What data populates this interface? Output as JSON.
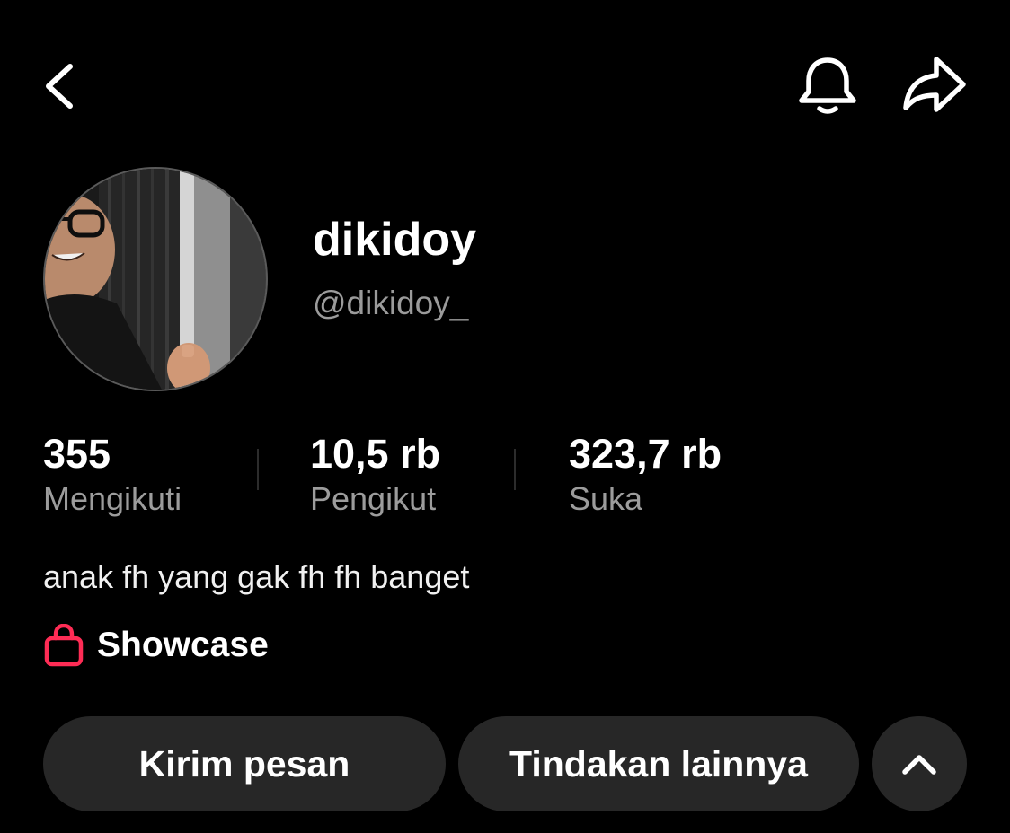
{
  "header": {
    "back_icon": "chevron-left-icon",
    "notifications_icon": "bell-icon",
    "share_icon": "share-arrow-icon"
  },
  "profile": {
    "display_name": "dikidoy",
    "username": "@dikidoy_",
    "bio": "anak fh yang gak fh fh banget"
  },
  "stats": [
    {
      "value": "355",
      "label": "Mengikuti"
    },
    {
      "value": "10,5 rb",
      "label": "Pengikut"
    },
    {
      "value": "323,7 rb",
      "label": "Suka"
    }
  ],
  "showcase": {
    "label": "Showcase",
    "icon": "shopping-bag-icon",
    "icon_color": "#fe2c55"
  },
  "actions": {
    "message_label": "Kirim pesan",
    "more_label": "Tindakan lainnya",
    "toggle_icon": "chevron-up-icon"
  },
  "colors": {
    "background": "#000000",
    "button_bg": "#272727",
    "secondary_text": "#9c9c9c",
    "accent": "#fe2c55"
  }
}
